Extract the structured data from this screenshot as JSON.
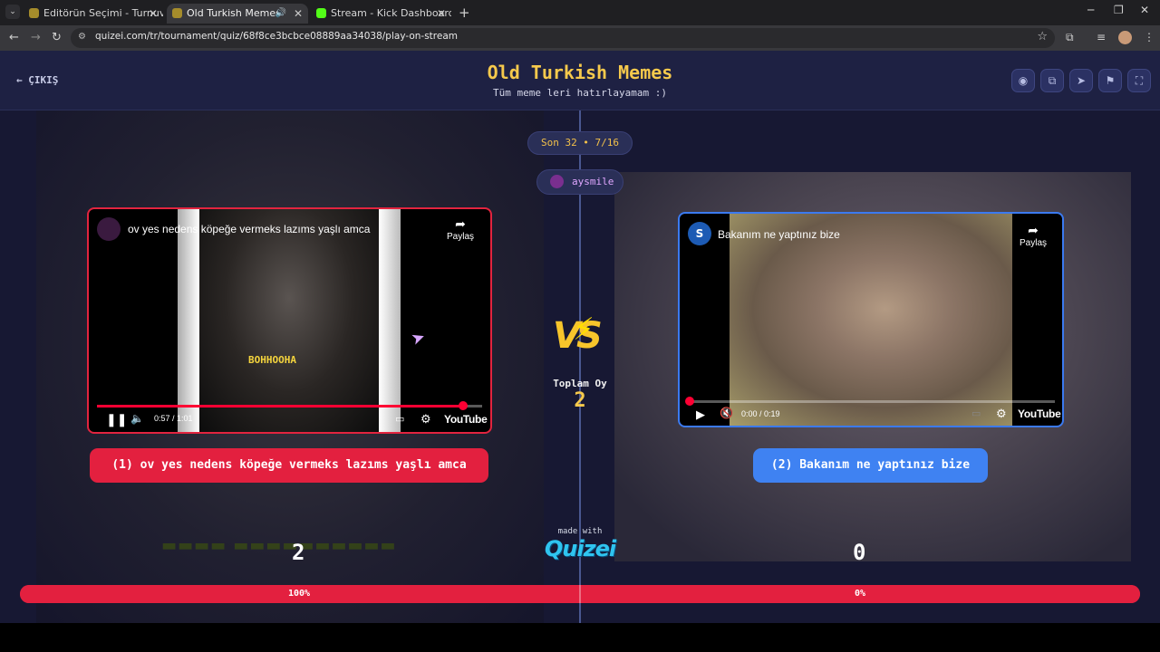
{
  "browser": {
    "tabs": [
      {
        "label": "Editörün Seçimi - Turnuva - Qu",
        "active": false
      },
      {
        "label": "Old Turkish Memes - Tier L",
        "active": true
      },
      {
        "label": "Stream - Kick Dashboard",
        "active": false
      }
    ],
    "url": "quizei.com/tr/tournament/quiz/68f8ce3bcbce08889aa34038/play-on-stream"
  },
  "header": {
    "exit_label": "ÇIKIŞ",
    "title": "Old Turkish Memes",
    "subtitle": "Tüm meme leri hatırlayamam :)",
    "buttons": [
      "eye-icon",
      "copy-icon",
      "send-icon",
      "flag-icon",
      "fullscreen-icon"
    ]
  },
  "round": {
    "label": "Son 32 • 7/16",
    "user": "aysmile",
    "total_label": "Toplam Oy",
    "total_value": "2"
  },
  "left": {
    "video_title": "ov yes nedens köpeğe vermeks lazıms yaşlı amca",
    "share_label": "Paylaş",
    "caption": "BOHHOOHA",
    "time": "0:57 / 1:01",
    "progress": 0.95,
    "button_label": "(1) ov yes nedens köpeğe vermeks lazıms yaşlı amca",
    "score": "2",
    "percent_label": "100%",
    "percent": 100,
    "color": "#e3203f"
  },
  "right": {
    "video_title": "Bakanım ne yaptınız bize",
    "channel_initial": "S",
    "share_label": "Paylaş",
    "time": "0:00 / 0:19",
    "progress": 0.0,
    "button_label": "(2) Bakanım ne yaptınız bize",
    "score": "0",
    "percent_label": "0%",
    "percent": 0,
    "color": "#3f82f2"
  },
  "branding": {
    "made_with": "made with",
    "logo": "Quizei",
    "youtube": "YouTube"
  }
}
